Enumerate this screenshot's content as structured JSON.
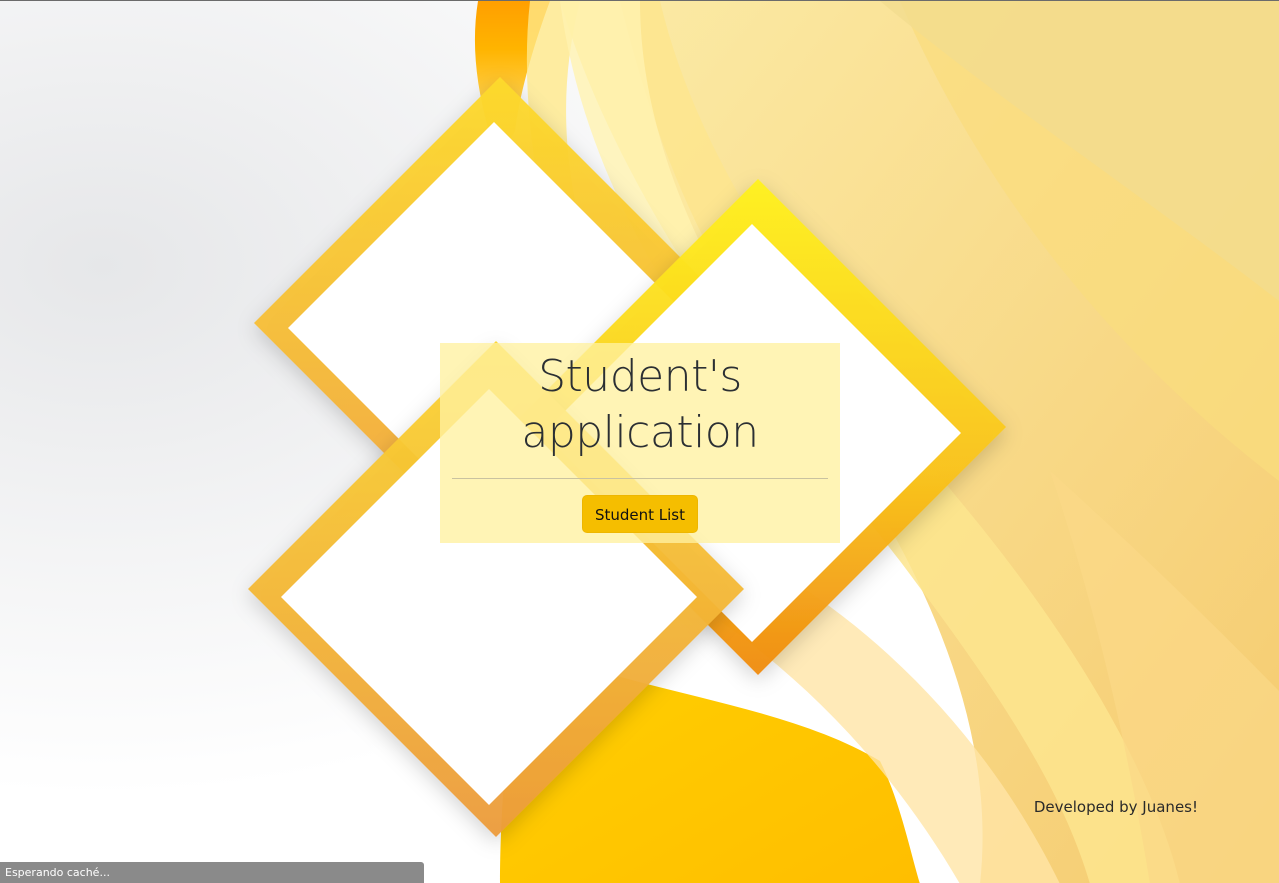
{
  "hero": {
    "title_line1": "Student's",
    "title_line2": "application",
    "button_label": "Student List"
  },
  "footer": {
    "credit": "Developed by Juanes!"
  },
  "browser": {
    "status_text": "Esperando caché..."
  },
  "colors": {
    "accent": "#f5be00",
    "panel": "#fff1a0",
    "frame_gold": "#f7c51e",
    "frame_orange": "#f29a1c"
  }
}
